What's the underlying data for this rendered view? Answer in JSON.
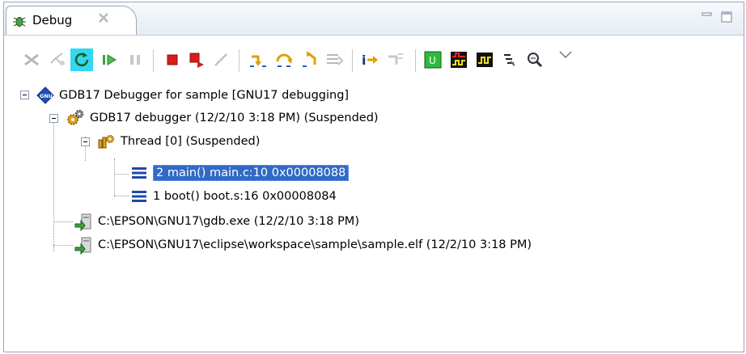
{
  "view": {
    "tab_label": "Debug",
    "tab_icon": "debug-bug-icon"
  },
  "toolbar": {
    "buttons": [
      "remove-terminated-icon",
      "remove-all-terminated-icon",
      "restart-icon",
      "resume-icon",
      "suspend-icon",
      "terminate-icon",
      "terminate-relaunch-icon",
      "disconnect-icon",
      "step-into-icon",
      "step-over-icon",
      "step-return-icon",
      "drop-to-frame-icon",
      "instruction-step-icon",
      "use-step-filters-icon",
      "u-mode-icon",
      "trace-icon",
      "waveform-icon",
      "step-icon",
      "zoom-icon",
      "view-menu-icon"
    ]
  },
  "tree": {
    "root": "GDB17 Debugger for sample [GNU17 debugging]",
    "debugger": "GDB17 debugger (12/2/10 3:18 PM) (Suspended)",
    "thread": "Thread [0] (Suspended)",
    "frames": [
      "2 main() main.c:10 0x00008088",
      "1 boot() boot.s:16 0x00008084"
    ],
    "processes": [
      "C:\\EPSON\\GNU17\\gdb.exe (12/2/10 3:18 PM)",
      "C:\\EPSON\\GNU17\\eclipse\\workspace\\sample\\sample.elf (12/2/10 3:18 PM)"
    ]
  },
  "colors": {
    "selection": "#3169c6",
    "accent_cyan": "#33d7f0",
    "terminate_red": "#d81c1c",
    "u_green": "#2fb83a"
  }
}
